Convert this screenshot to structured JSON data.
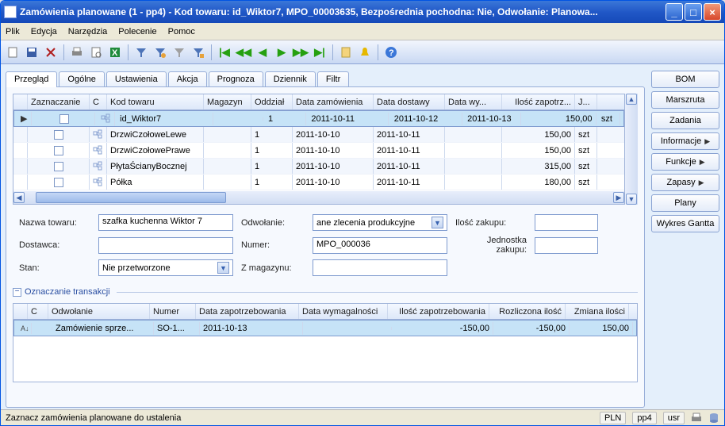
{
  "window_title": "Zamówienia planowane (1 - pp4) - Kod towaru: id_Wiktor7, MPO_00003635, Bezpośrednia pochodna: Nie, Odwołanie: Planowa...",
  "menu": [
    "Plik",
    "Edycja",
    "Narzędzia",
    "Polecenie",
    "Pomoc"
  ],
  "tabs": [
    "Przegląd",
    "Ogólne",
    "Ustawienia",
    "Akcja",
    "Prognoza",
    "Dziennik",
    "Filtr"
  ],
  "grid": {
    "headers": [
      "Zaznaczanie",
      "C",
      "Kod towaru",
      "Magazyn",
      "Oddział",
      "Data zamówienia",
      "Data dostawy",
      "Data wy...",
      "Ilość zapotrz...",
      "J..."
    ],
    "rows": [
      {
        "sel": true,
        "kod": "id_Wiktor7",
        "mag": "",
        "odd": "1",
        "dz": "2011-10-11",
        "dd": "2011-10-12",
        "dw": "2011-10-13",
        "il": "150,00",
        "j": "szt"
      },
      {
        "sel": false,
        "kod": "DrzwiCzołoweLewe",
        "mag": "",
        "odd": "1",
        "dz": "2011-10-10",
        "dd": "2011-10-11",
        "dw": "",
        "il": "150,00",
        "j": "szt"
      },
      {
        "sel": false,
        "kod": "DrzwiCzołowePrawe",
        "mag": "",
        "odd": "1",
        "dz": "2011-10-10",
        "dd": "2011-10-11",
        "dw": "",
        "il": "150,00",
        "j": "szt"
      },
      {
        "sel": false,
        "kod": "PłytaŚcianyBocznej",
        "mag": "",
        "odd": "1",
        "dz": "2011-10-10",
        "dd": "2011-10-11",
        "dw": "",
        "il": "315,00",
        "j": "szt"
      },
      {
        "sel": false,
        "kod": "Półka",
        "mag": "",
        "odd": "1",
        "dz": "2011-10-10",
        "dd": "2011-10-11",
        "dw": "",
        "il": "180,00",
        "j": "szt"
      }
    ]
  },
  "form": {
    "nazwa_label": "Nazwa towaru:",
    "nazwa": "szafka kuchenna Wiktor 7",
    "odwolanie_label": "Odwołanie:",
    "odwolanie": "ane zlecenia produkcyjne",
    "ilosc_zakupu_label": "Ilość zakupu:",
    "ilosc_zakupu": "",
    "dostawca_label": "Dostawca:",
    "dostawca": "",
    "numer_label": "Numer:",
    "numer": "MPO_000036",
    "jednostka_label": "Jednostka zakupu:",
    "jednostka": "",
    "stan_label": "Stan:",
    "stan": "Nie przetworzone",
    "zmag_label": "Z magazynu:",
    "zmag": ""
  },
  "section": {
    "title": "Oznaczanie transakcji",
    "headers": [
      "C",
      "Odwołanie",
      "Numer",
      "Data zapotrzebowania",
      "Data wymagalności",
      "Ilość zapotrzebowania",
      "Rozliczona ilość",
      "Zmiana ilości"
    ],
    "row": {
      "odw": "Zamówienie sprze...",
      "num": "SO-1...",
      "dz": "2011-10-13",
      "dw": "",
      "il": "-150,00",
      "roz": "-150,00",
      "zmi": "150,00"
    }
  },
  "side_buttons": [
    {
      "label": "BOM",
      "arrow": false
    },
    {
      "label": "Marszruta",
      "arrow": false
    },
    {
      "label": "Zadania",
      "arrow": false
    },
    {
      "label": "Informacje",
      "arrow": true
    },
    {
      "label": "Funkcje",
      "arrow": true
    },
    {
      "label": "Zapasy",
      "arrow": true
    },
    {
      "label": "Plany",
      "arrow": false
    },
    {
      "label": "Wykres Gantta",
      "arrow": false
    }
  ],
  "statusbar": {
    "text": "Zaznacz zamówienia planowane do ustalenia",
    "currency": "PLN",
    "company": "pp4",
    "user": "usr"
  }
}
